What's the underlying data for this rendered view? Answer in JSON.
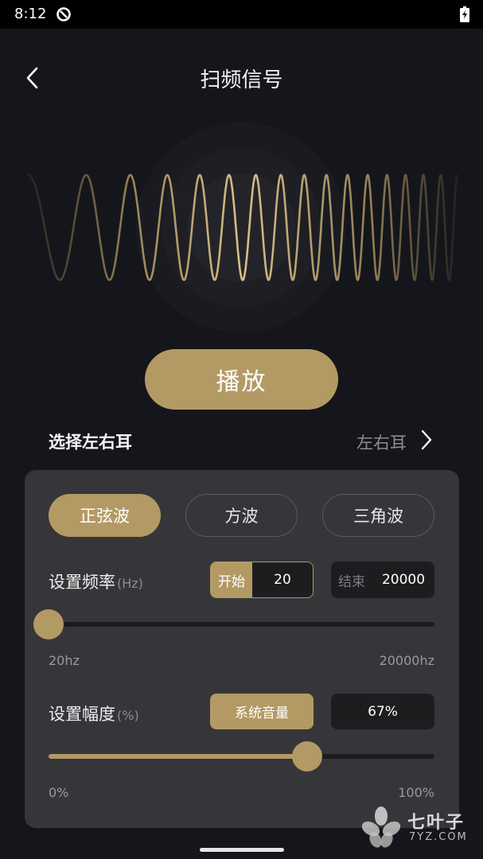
{
  "status_bar": {
    "time": "8:12"
  },
  "header": {
    "title": "扫频信号"
  },
  "play_button": {
    "label": "播放"
  },
  "ear_select": {
    "label": "选择左右耳",
    "value": "左右耳"
  },
  "wave_tabs": [
    {
      "label": "正弦波",
      "active": true
    },
    {
      "label": "方波",
      "active": false
    },
    {
      "label": "三角波",
      "active": false
    }
  ],
  "frequency": {
    "label": "设置频率",
    "unit": "(Hz)",
    "start_tag": "开始",
    "start_value": "20",
    "end_tag": "结束",
    "end_value": "20000",
    "min_label": "20hz",
    "max_label": "20000hz",
    "slider_fraction": 0.0
  },
  "amplitude": {
    "label": "设置幅度",
    "unit": "(%)",
    "system_volume_label": "系统音量",
    "value": "67%",
    "min_label": "0%",
    "max_label": "100%",
    "slider_fraction": 0.67
  },
  "watermark": {
    "title": "七叶子",
    "subtitle": "7YZ.COM"
  },
  "colors": {
    "accent": "#b39a64",
    "background": "#15161b",
    "panel": "#36363a"
  }
}
